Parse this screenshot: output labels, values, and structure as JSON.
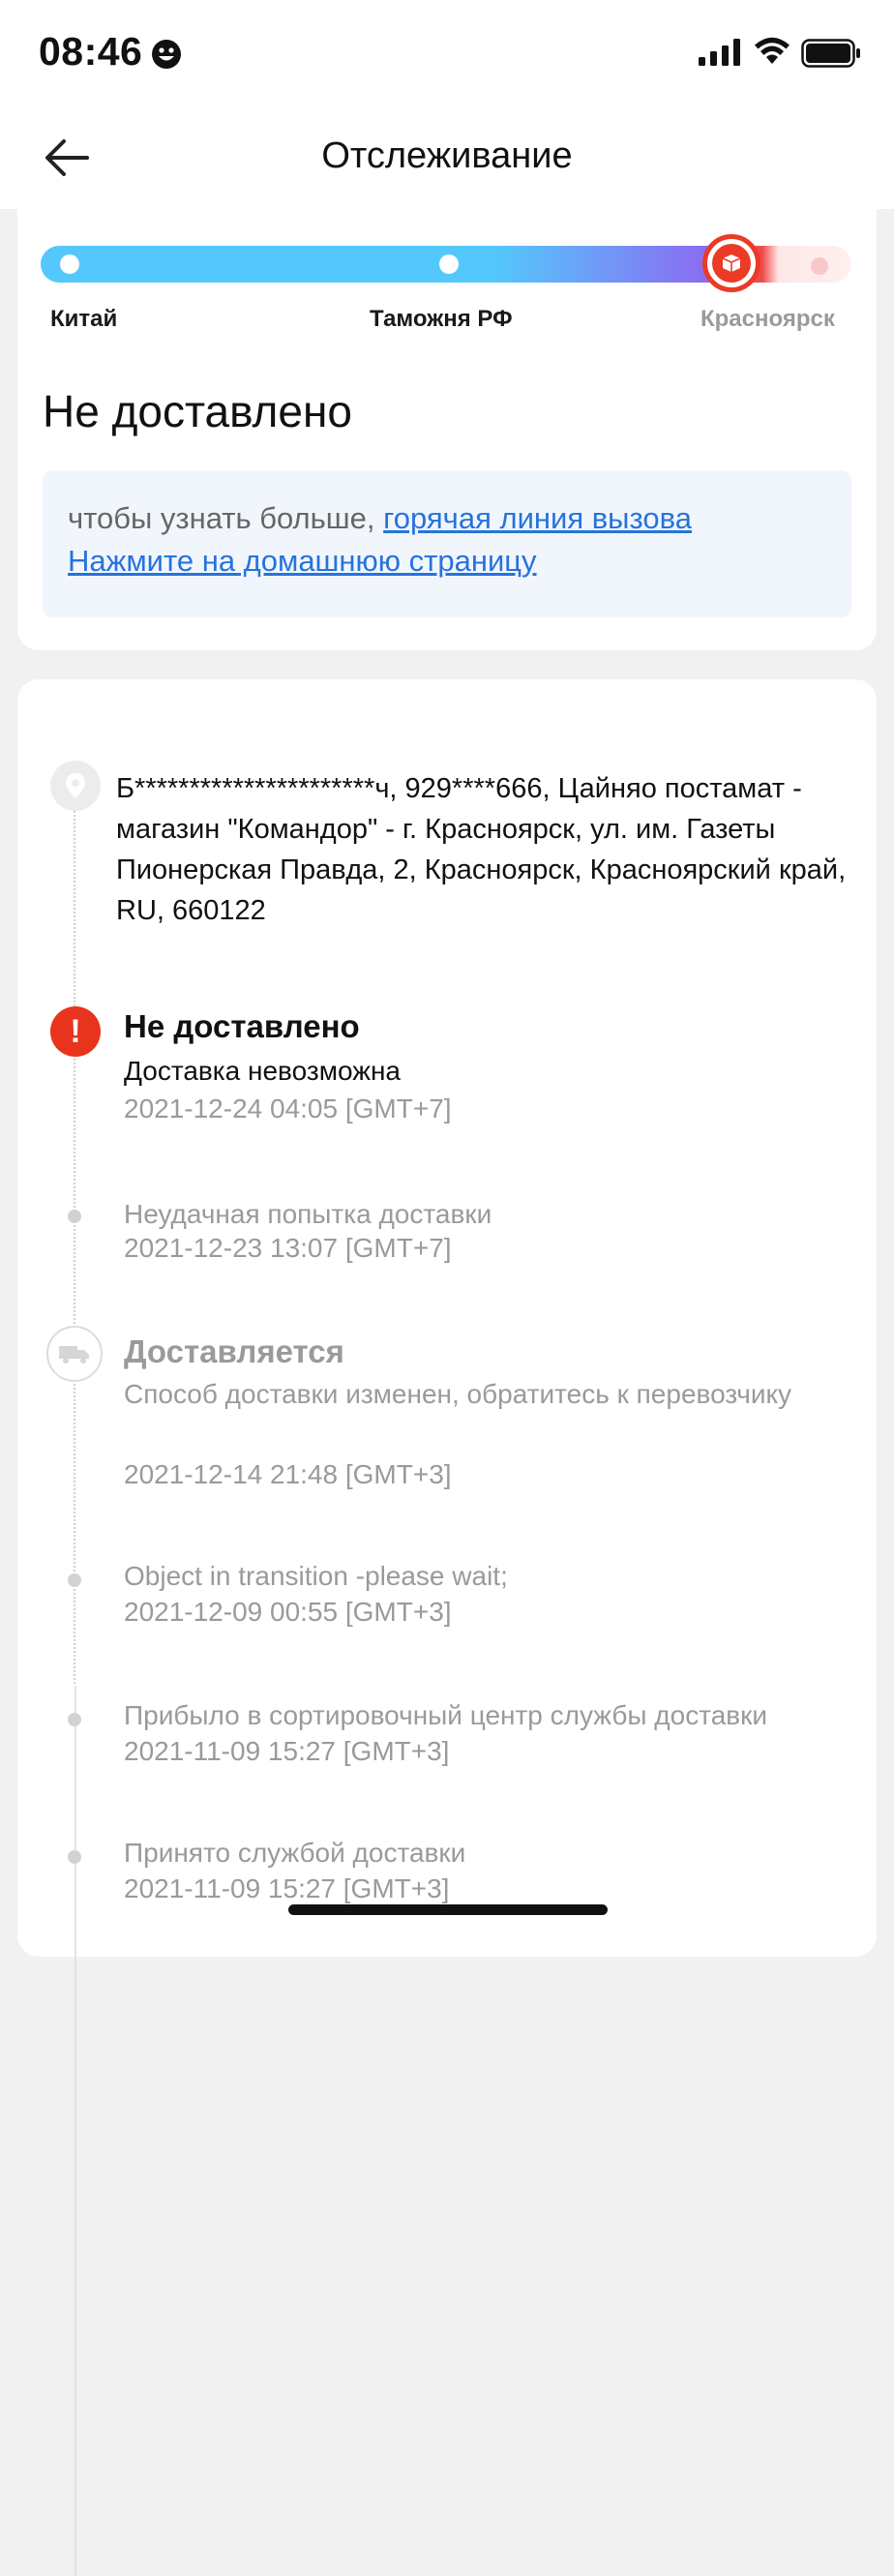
{
  "status_bar": {
    "time": "08:46",
    "icons": [
      "smiley-icon",
      "cellular-signal-icon",
      "wifi-icon",
      "battery-icon"
    ]
  },
  "header": {
    "title": "Отслеживание",
    "back_icon": "arrow-left-icon"
  },
  "progress": {
    "stages": [
      "Китай",
      "Таможня РФ",
      "Красноярск"
    ],
    "current_icon": "package-icon",
    "colors": {
      "track_start": "#54c8fc",
      "track_mid": "#8b6cf2",
      "current": "#eb3a26",
      "upcoming": "#f9c7c9"
    }
  },
  "delivery_status": "Не доставлено",
  "info_box": {
    "line1_text": "чтобы узнать больше, ",
    "hotline_link": "горячая линия вызова",
    "homepage_link": "Нажмите на домашнюю страницу"
  },
  "address": "Б**********************ч, 929****666, Цайняо постамат - магазин \"Командор\" - г. Красноярск, ул. им. Газеты Пионерская Правда, 2, Красноярск, Красноярский край, RU, 660122",
  "events": [
    {
      "title": "Не доставлено",
      "description": "Доставка невозможна",
      "time": "2021-12-24 04:05 [GMT+7]"
    },
    {
      "description": "Неудачная попытка доставки",
      "time": "2021-12-23 13:07 [GMT+7]"
    },
    {
      "title": "Доставляется",
      "description": "Способ доставки изменен, обратитесь к перевозчику",
      "time": "2021-12-14 21:48 [GMT+3]"
    },
    {
      "description": "Object in transition -please wait;",
      "time": "2021-12-09 00:55 [GMT+3]"
    },
    {
      "description": "Прибыло в сортировочный центр службы доставки",
      "time": "2021-11-09 15:27 [GMT+3]"
    },
    {
      "description": "Принято службой доставки",
      "time": "2021-11-09 15:27 [GMT+3]"
    }
  ],
  "colors": {
    "accent_red": "#e8341c",
    "link_blue": "#2673dd",
    "muted_text": "#9a9a9a"
  }
}
